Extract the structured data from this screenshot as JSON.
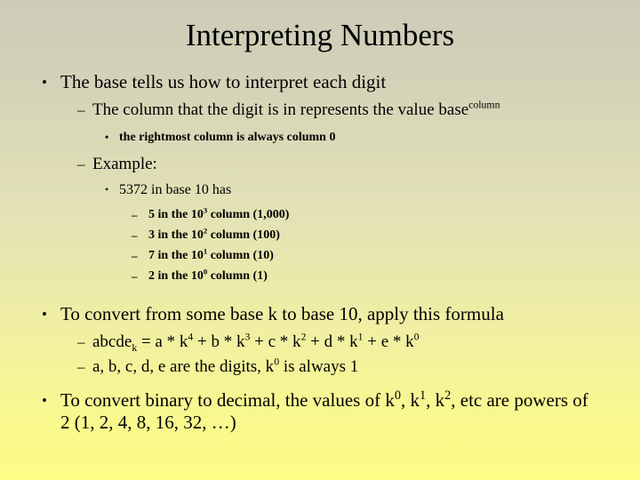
{
  "slide": {
    "title": "Interpreting Numbers",
    "bullet_glyphs": {
      "level1": "•",
      "level2": "–",
      "level3": "•",
      "level4": "–"
    },
    "colors": {
      "background_top": "#ccccb9",
      "background_mid": "#e8e8b4",
      "background_bottom": "#fcfc86",
      "text": "#000000"
    },
    "content": [
      {
        "level": 1,
        "text": "The base tells us how to interpret each digit"
      },
      {
        "level": 2,
        "text_before": "The column that the digit is in represents the value base",
        "superscript": "column",
        "text_after": ""
      },
      {
        "level": 3,
        "text": "the rightmost column is always column 0"
      },
      {
        "level": 2,
        "text": "Example:"
      },
      {
        "level": 3,
        "text": "5372 in base 10 has"
      },
      {
        "level": 4,
        "text_before": "5 in the 10",
        "superscript": "3",
        "text_after": " column (1,000)"
      },
      {
        "level": 4,
        "text_before": "3 in the 10",
        "superscript": "2",
        "text_after": " column (100)"
      },
      {
        "level": 4,
        "text_before": "7 in the 10",
        "superscript": "1",
        "text_after": " column (10)"
      },
      {
        "level": 4,
        "text_before": "2 in the 10",
        "superscript": "0",
        "text_after": " column (1)"
      },
      {
        "level": 1,
        "text": "To convert from some base k to base 10, apply this formula"
      },
      {
        "level": 2,
        "formula": {
          "lhs_base": "abcde",
          "lhs_sub": "k",
          "equals": " = a * k",
          "p4": "4",
          "t1": " + b * k",
          "p3": "3",
          "t2": " + c * k",
          "p2": "2",
          "t3": " + d * k",
          "p1": "1",
          "t4": " + e * k",
          "p0": "0"
        }
      },
      {
        "level": 2,
        "text_before": "a, b, c, d, e are the digits, k",
        "superscript": "0",
        "text_after": " is always 1"
      },
      {
        "level": 1,
        "last_bullet": {
          "part1": "To convert binary to decimal, the values of k",
          "sup1": "0",
          "part2": ", k",
          "sup2": "1",
          "part3": ", k",
          "sup3": "2",
          "part4": ", etc are powers of 2 (1, 2, 4, 8, 16, 32, …)"
        }
      }
    ]
  }
}
